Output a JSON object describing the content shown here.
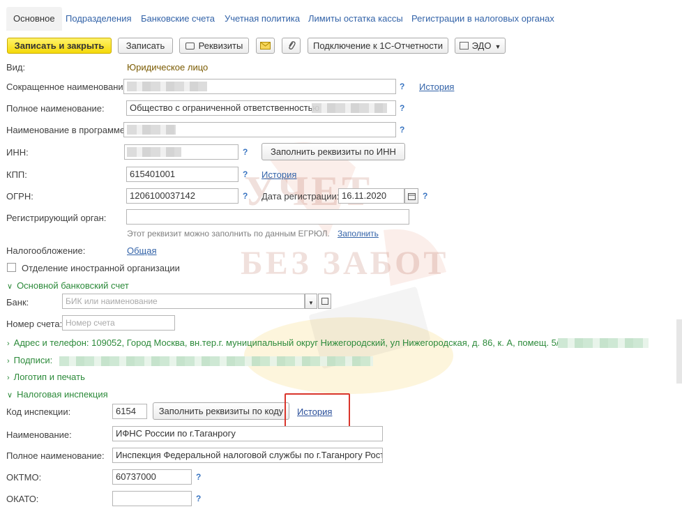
{
  "tabs": [
    "Основное",
    "Подразделения",
    "Банковские счета",
    "Учетная политика",
    "Лимиты остатка кассы",
    "Регистрации в налоговых органах"
  ],
  "toolbar": {
    "save_close": "Записать и закрыть",
    "save": "Записать",
    "requisites": "Реквизиты",
    "connect": "Подключение к 1С-Отчетности",
    "edo": "ЭДО"
  },
  "form": {
    "vid_label": "Вид:",
    "vid_value": "Юридическое лицо",
    "short_name_label": "Сокращенное наименование:",
    "full_name_label": "Полное наименование:",
    "full_name_value": "Общество с ограниченной ответственностью",
    "program_name_label": "Наименование в программе:",
    "inn_label": "ИНН:",
    "fill_by_inn": "Заполнить реквизиты по ИНН",
    "kpp_label": "КПП:",
    "kpp_value": "615401001",
    "ogrn_label": "ОГРН:",
    "ogrn_value": "1206100037142",
    "reg_date_label": "Дата регистрации:",
    "reg_date_value": "16.11.2020",
    "reg_organ_label": "Регистрирующий орган:",
    "egrul_hint": "Этот реквизит можно заполнить по данным ЕГРЮЛ.",
    "fill_link": "Заполнить",
    "tax_label": "Налогообложение:",
    "tax_value": "Общая",
    "foreign_label": "Отделение иностранной организации",
    "history": "История",
    "q": "?"
  },
  "bank": {
    "section": "Основной банковский счет",
    "bank_label": "Банк:",
    "bank_placeholder": "БИК или наименование",
    "account_label": "Номер счета:",
    "account_placeholder": "Номер счета"
  },
  "sections": {
    "address": "Адрес и телефон: 109052, Город Москва, вн.тер.г. муниципальный округ Нижегородский, ул Нижегородская, д. 86, к. А, помещ. 5/1, т",
    "signatures": "Подписи:",
    "logo": "Логотип и печать",
    "tax_office": "Налоговая инспекция"
  },
  "tax_office": {
    "code_label": "Код инспекции:",
    "code_value": "6154",
    "fill_by_code": "Заполнить реквизиты по коду",
    "history": "История",
    "name_label": "Наименование:",
    "name_value": "ИФНС России по г.Таганрогу",
    "full_name_label": "Полное наименование:",
    "full_name_value": "Инспекция Федеральной налоговой службы по г.Таганрогу Ростов",
    "oktmo_label": "ОКТМО:",
    "oktmo_value": "60737000",
    "okato_label": "ОКАТО:",
    "okato_value": ""
  },
  "watermark": {
    "line1": "УЧЕТ",
    "line2": "БЕЗ ЗАБОТ"
  },
  "colors": {
    "highlight": "#d9352b",
    "accent_yellow": "#f5d90a",
    "link": "#3363a8",
    "section_green": "#2c8a3a"
  }
}
